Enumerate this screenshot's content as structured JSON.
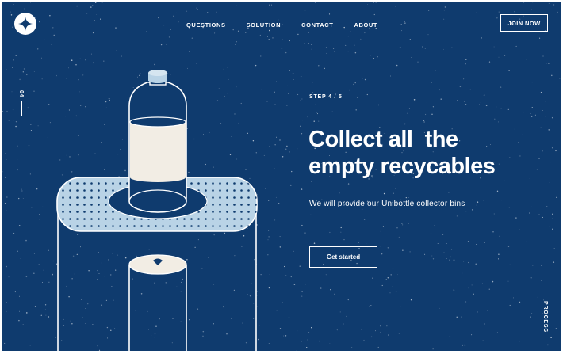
{
  "nav": {
    "items": [
      "QUESTIONS",
      "SOLUTION",
      "CONTACT",
      "ABOUT"
    ],
    "join_label": "JOIN NOW"
  },
  "side": {
    "section_number": "04",
    "process_label": "PROCESS"
  },
  "hero": {
    "step": "STEP 4 / 5",
    "headline_line1": "Collect all  the",
    "headline_line2": "empty recycables",
    "subtext": "We will provide our Unibottle collector bins",
    "cta_label": "Get started"
  },
  "colors": {
    "background": "#0f3b6e",
    "foreground": "#ffffff",
    "bin_fill": "#b9d3e6",
    "label_fill": "#f2ede4"
  },
  "icons": {
    "logo": "sparkle-star-icon"
  }
}
